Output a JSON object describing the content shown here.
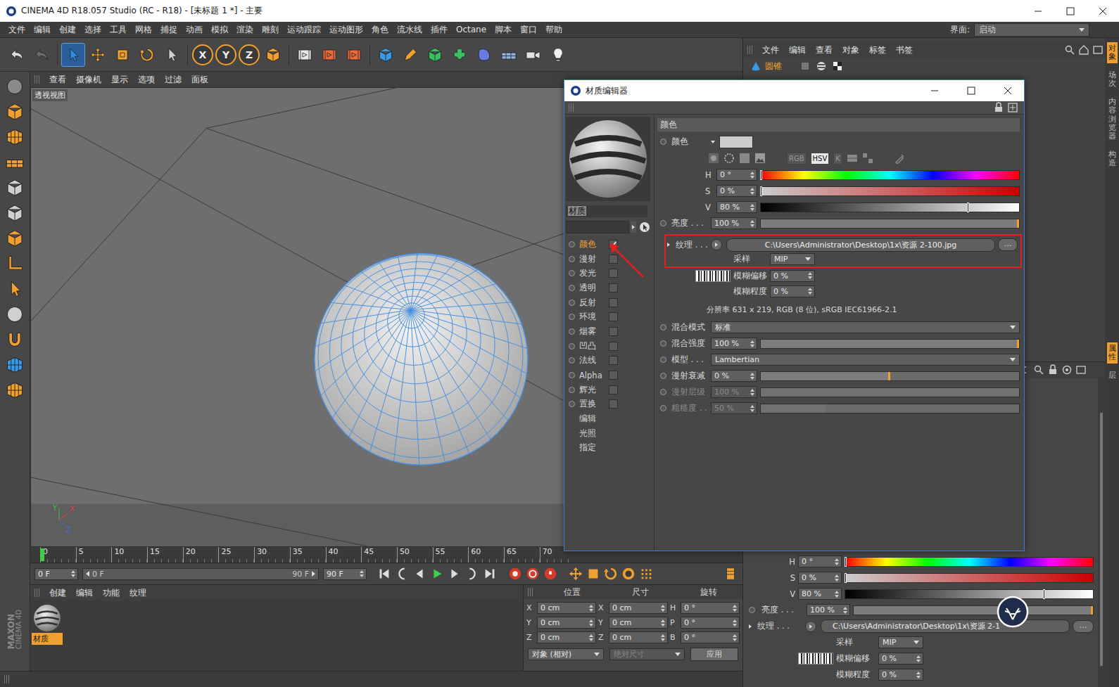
{
  "window": {
    "title": "CINEMA 4D R18.057 Studio (RC - R18) - [未标题 1 *] - 主要"
  },
  "menu": [
    "文件",
    "编辑",
    "创建",
    "选择",
    "工具",
    "网格",
    "捕捉",
    "动画",
    "模拟",
    "渲染",
    "雕刻",
    "运动跟踪",
    "运动图形",
    "角色",
    "流水线",
    "插件",
    "Octane",
    "脚本",
    "窗口",
    "帮助"
  ],
  "layout": {
    "label": "界面:",
    "value": "启动"
  },
  "axisButtons": [
    "X",
    "Y",
    "Z"
  ],
  "viewport": {
    "menu": [
      "查看",
      "摄像机",
      "显示",
      "选项",
      "过滤",
      "面板"
    ],
    "label": "透视视图",
    "axes": [
      {
        "label": "Y",
        "color": "#3fbf3f"
      },
      {
        "label": "X",
        "color": "#e04040"
      },
      {
        "label": "Z",
        "color": "#4a6ae8"
      }
    ]
  },
  "timeline": {
    "ticks": [
      "0",
      "5",
      "10",
      "15",
      "20",
      "25",
      "30",
      "35",
      "40",
      "45",
      "50",
      "55",
      "60",
      "65",
      "70"
    ],
    "playhead": 0,
    "current": "0 F",
    "rangeStart": "0 F",
    "rangeEnd": "90 F",
    "end": "90 F"
  },
  "brand": {
    "maker": "MAXON",
    "product": "CINEMA 4D"
  },
  "materialManager": {
    "menu": [
      "创建",
      "编辑",
      "功能",
      "纹理"
    ],
    "materials": [
      {
        "name": "材质",
        "selected": true
      }
    ]
  },
  "coordinates": {
    "headers": [
      "位置",
      "尺寸",
      "旋转"
    ],
    "rows": [
      {
        "axis": "X",
        "position": "0 cm",
        "sizeAxis": "X",
        "size": "0 cm",
        "rotAxis": "H",
        "rotation": "0 °"
      },
      {
        "axis": "Y",
        "position": "0 cm",
        "sizeAxis": "Y",
        "size": "0 cm",
        "rotAxis": "P",
        "rotation": "0 °"
      },
      {
        "axis": "Z",
        "position": "0 cm",
        "sizeAxis": "Z",
        "size": "0 cm",
        "rotAxis": "B",
        "rotation": "0 °"
      }
    ],
    "mode": "对象 (相对)",
    "sizeMode": {
      "label": "绝对尺寸",
      "disabled": true
    },
    "apply": "应用"
  },
  "objectManager": {
    "menu": [
      "文件",
      "编辑",
      "查看",
      "对象",
      "标签",
      "书签"
    ],
    "objects": [
      {
        "name": "圆锥",
        "selected": true
      }
    ]
  },
  "sideTabs": {
    "top": [
      {
        "label": "对象",
        "selected": true
      },
      {
        "label": "场次",
        "selected": false
      },
      {
        "label": "内容浏览器",
        "selected": false
      },
      {
        "label": "构造",
        "selected": false
      }
    ],
    "bottom": [
      {
        "label": "属性",
        "selected": true
      },
      {
        "label": "层",
        "selected": false
      }
    ]
  },
  "attributes": {
    "hsv": [
      {
        "label": "H",
        "value": "0 °",
        "level": 0,
        "kind": "hue"
      },
      {
        "label": "S",
        "value": "0 %",
        "level": 0,
        "kind": "sat"
      },
      {
        "label": "V",
        "value": "80 %",
        "level": 0.8,
        "kind": "val"
      }
    ],
    "brightness": {
      "label": "亮度 . . .",
      "value": "100 %",
      "level": 1
    },
    "texture": {
      "label": "纹理 . . .",
      "path": "C:\\Users\\Administrator\\Desktop\\1x\\资源 2-1",
      "button": "..."
    },
    "sampling": {
      "label": "采样",
      "value": "MIP"
    },
    "blur": [
      {
        "label": "模糊偏移",
        "value": "0 %",
        "thumb": true
      },
      {
        "label": "模糊程度",
        "value": "0 %",
        "thumb": false
      }
    ]
  },
  "materialEditor": {
    "title": "材质编辑器",
    "name": "材质",
    "channels": [
      {
        "label": "颜色",
        "kind": "channel",
        "checked": true,
        "selected": true
      },
      {
        "label": "漫射",
        "kind": "channel",
        "checked": false,
        "selected": false
      },
      {
        "label": "发光",
        "kind": "channel",
        "checked": false,
        "selected": false
      },
      {
        "label": "透明",
        "kind": "channel",
        "checked": false,
        "selected": false
      },
      {
        "label": "反射",
        "kind": "channel",
        "checked": false,
        "selected": false
      },
      {
        "label": "环境",
        "kind": "channel",
        "checked": false,
        "selected": false
      },
      {
        "label": "烟雾",
        "kind": "channel",
        "checked": false,
        "selected": false
      },
      {
        "label": "凹凸",
        "kind": "channel",
        "checked": false,
        "selected": false
      },
      {
        "label": "法线",
        "kind": "channel",
        "checked": false,
        "selected": false
      },
      {
        "label": "Alpha",
        "kind": "channel",
        "checked": false,
        "selected": false
      },
      {
        "label": "辉光",
        "kind": "channel",
        "checked": false,
        "selected": false
      },
      {
        "label": "置换",
        "kind": "channel",
        "checked": false,
        "selected": false
      },
      {
        "label": "编辑",
        "kind": "page",
        "selected": false
      },
      {
        "label": "光照",
        "kind": "page",
        "selected": false
      },
      {
        "label": "指定",
        "kind": "page",
        "selected": false
      }
    ],
    "section": "颜色",
    "color": {
      "label": "颜色",
      "swatch": "#cccccc"
    },
    "modes": [
      {
        "label": "RGB",
        "selected": false
      },
      {
        "label": "HSV",
        "selected": true
      },
      {
        "label": "K",
        "selected": false
      }
    ],
    "hsv": [
      {
        "label": "H",
        "value": "0 °",
        "level": 0,
        "kind": "hue"
      },
      {
        "label": "S",
        "value": "0 %",
        "level": 0,
        "kind": "sat"
      },
      {
        "label": "V",
        "value": "80 %",
        "level": 0.8,
        "kind": "val"
      }
    ],
    "params": [
      {
        "kind": "slider",
        "label": "亮度 . . .",
        "value": "100 %",
        "level": 1,
        "disabled": false
      },
      {
        "kind": "texture",
        "label": "纹理 . . .",
        "path": "C:\\Users\\Administrator\\Desktop\\1x\\资源 2-100.jpg",
        "button": "...",
        "highlighted": true,
        "sampling": {
          "label": "采样",
          "value": "MIP"
        }
      },
      {
        "kind": "sub",
        "label": "模糊偏移",
        "value": "0 %",
        "thumb": true
      },
      {
        "kind": "sub",
        "label": "模糊程度",
        "value": "0 %",
        "thumb": false
      },
      {
        "kind": "info",
        "text": "分辨率 631 x 219, RGB (8 位), sRGB IEC61966-2.1"
      },
      {
        "kind": "select",
        "label": "混合模式",
        "value": "标准"
      },
      {
        "kind": "slider",
        "label": "混合强度",
        "value": "100 %",
        "level": 1,
        "disabled": false
      },
      {
        "kind": "select",
        "label": "模型 . . .",
        "value": "Lambertian"
      },
      {
        "kind": "slider",
        "label": "漫射衰减",
        "value": "0 %",
        "level": 0.5,
        "disabled": false
      },
      {
        "kind": "slider",
        "label": "漫射层级",
        "value": "100 %",
        "level": 1,
        "disabled": true
      },
      {
        "kind": "slider",
        "label": "粗糙度 . . .",
        "value": "50 %",
        "level": 0.25,
        "disabled": true
      }
    ]
  }
}
